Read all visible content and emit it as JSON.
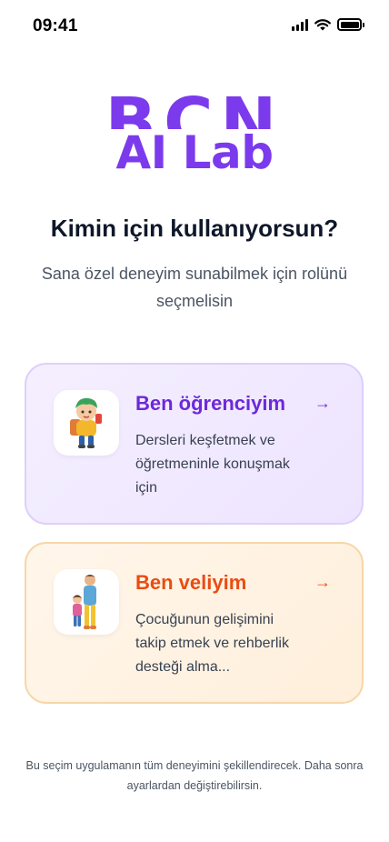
{
  "status_bar": {
    "time": "09:41"
  },
  "logo": {
    "top_text": "BCN",
    "bottom_text": "AI Lab"
  },
  "title": "Kimin için kullanıyorsun?",
  "subtitle": "Sana özel deneyim sunabilmek için rolünü seçmelisin",
  "roles": [
    {
      "title": "Ben öğrenciyim",
      "description": "Dersleri keşfetmek ve öğretmeninle konuşmak için",
      "icon": "student-avatar-icon"
    },
    {
      "title": "Ben veliyim",
      "description": "Çocuğunun gelişimini takip etmek ve rehberlik desteği alma...",
      "icon": "parent-child-avatar-icon"
    }
  ],
  "footer": "Bu seçim uygulamanın tüm deneyimini şekillendirecek. Daha sonra ayarlardan değiştirebilirsin.",
  "colors": {
    "brand": "#7c3aed",
    "student_accent": "#6d28d9",
    "parent_accent": "#ea4c12"
  }
}
